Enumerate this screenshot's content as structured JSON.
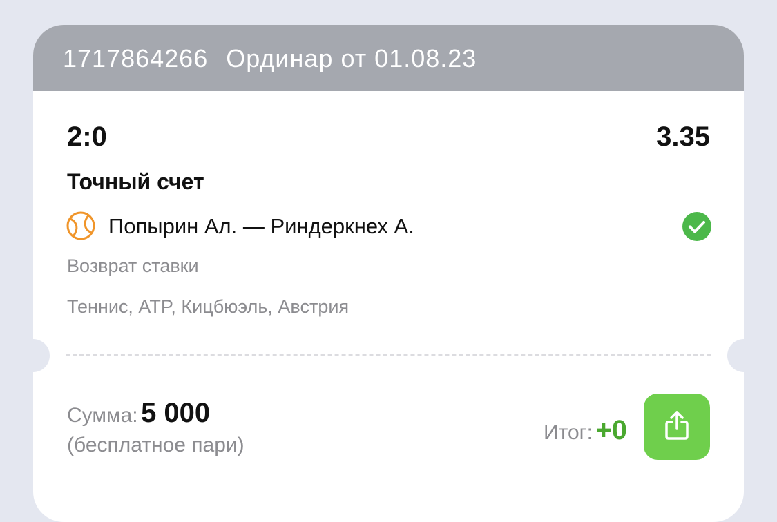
{
  "header": {
    "bet_id": "1717864266",
    "bet_type": "Ординар от 01.08.23"
  },
  "selection": {
    "score": "2:0",
    "odds": "3.35",
    "market": "Точный счет",
    "match": "Попырин Ал. — Риндеркнех А.",
    "status": "Возврат ставки",
    "category": "Теннис,  ATP, Кицбюэль, Австрия"
  },
  "icons": {
    "sport": "tennis-ball-icon",
    "status": "check-circle-icon",
    "share": "share-icon"
  },
  "footer": {
    "sum_label": "Сумма:",
    "sum_value": "5 000",
    "sum_note": "(бесплатное пари)",
    "result_label": "Итог:",
    "result_value": "+0"
  },
  "colors": {
    "header_bg": "#a5a8af",
    "accent_green": "#6fcf4c",
    "result_green": "#4aa82f",
    "tennis_orange": "#f0952a",
    "check_green": "#4cb84a"
  }
}
